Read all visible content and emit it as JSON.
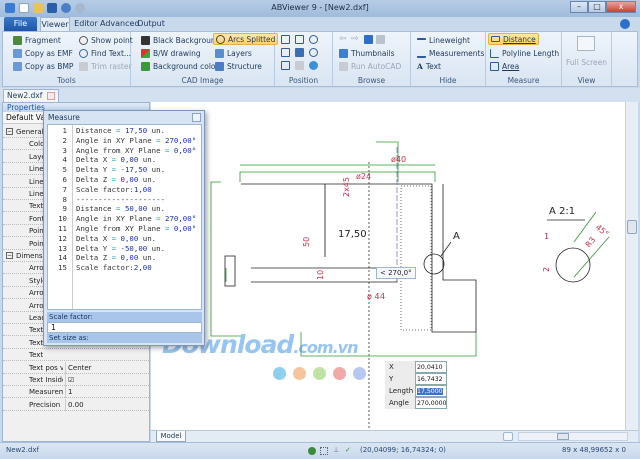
{
  "window": {
    "title": "ABViewer 9 - [New2.dxf]",
    "minimize": "–",
    "maximize": "□",
    "close": "x"
  },
  "menu_tabs": [
    "File",
    "Viewer",
    "Editor",
    "Advanced",
    "Output"
  ],
  "ribbon": {
    "tools": {
      "label": "Tools",
      "items": [
        "Fragment",
        "Show point",
        "Copy as EMF",
        "Find Text...",
        "Copy as BMP",
        "Trim raster"
      ]
    },
    "cad_image": {
      "label": "CAD Image",
      "items": [
        "Black Background",
        "Arcs Splitted",
        "B/W drawing",
        "Layers",
        "Background color",
        "Structure"
      ]
    },
    "position": {
      "label": "Position"
    },
    "browse": {
      "label": "Browse",
      "items": [
        "Thumbnails",
        "Run AutoCAD"
      ]
    },
    "hide": {
      "label": "Hide",
      "items": [
        "Lineweight",
        "Measurements",
        "Text"
      ]
    },
    "measure": {
      "label": "Measure",
      "items": [
        "Distance",
        "Polyline Length",
        "Area"
      ]
    },
    "view": {
      "label": "View",
      "items": [
        "Full Screen"
      ]
    }
  },
  "doc_tab": "New2.dxf",
  "properties": {
    "title": "Properties",
    "default_values": "Default Valu",
    "rows": [
      {
        "name": "General",
        "value": "",
        "cat": true
      },
      {
        "name": "Color",
        "value": ""
      },
      {
        "name": "Layer",
        "value": ""
      },
      {
        "name": "Linetype",
        "value": ""
      },
      {
        "name": "Linetype",
        "value": ""
      },
      {
        "name": "Line W",
        "value": ""
      },
      {
        "name": "Text",
        "value": ""
      },
      {
        "name": "Font",
        "value": ""
      },
      {
        "name": "Point",
        "value": ""
      },
      {
        "name": "Point",
        "value": ""
      },
      {
        "name": "Dimension",
        "value": "",
        "cat": true
      },
      {
        "name": "Arrow",
        "value": ""
      },
      {
        "name": "Style",
        "value": ""
      },
      {
        "name": "Arrow",
        "value": ""
      },
      {
        "name": "Arrow",
        "value": ""
      },
      {
        "name": "Leader",
        "value": ""
      },
      {
        "name": "Text",
        "value": ""
      },
      {
        "name": "Text",
        "value": ""
      },
      {
        "name": "Text",
        "value": ""
      },
      {
        "name": "Text pos ve",
        "value": "Center"
      },
      {
        "name": "Text Inside",
        "value": "☑"
      },
      {
        "name": "Measuremen",
        "value": "1"
      },
      {
        "name": "Precision",
        "value": "0.00"
      }
    ]
  },
  "measure_panel": {
    "title": "Measure",
    "lines": [
      "Distance = 17,50 un.",
      "Angle in XY Plane = 270,00°",
      "Angle from XY Plane = 0,00°",
      "Delta X = 0,00 un.",
      "Delta Y = -17,50 un.",
      "Delta Z = 0,00 un.",
      "Scale factor:1,00",
      "--------------------",
      "Distance = 50,00 un.",
      "Angle in XY Plane = 270,00°",
      "Angle from XY Plane = 0,00°",
      "Delta X = 0,00 un.",
      "Delta Y = -50,00 un.",
      "Delta Z = 0,00 un.",
      "Scale factor:2,00"
    ],
    "scale_factor_label": "Scale factor:",
    "scale_factor_value": "1",
    "set_size_label": "Set size as:"
  },
  "drawing": {
    "dims": {
      "d40": "ø40",
      "d24": "ø24",
      "chamfer": "2x45",
      "h50": "50",
      "h10": "10",
      "d4": "ø 4",
      "d4b": "4",
      "measured": "17,50",
      "section": "A",
      "detail_title": "A  2:1",
      "d1": "1",
      "d2": "2",
      "r3": "R3",
      "a45": "45°"
    },
    "angle_tip": "< 270,0°",
    "readout": {
      "x_label": "X",
      "x": "20,0410",
      "y_label": "Y",
      "y": "16,7432",
      "length_label": "Length",
      "length": "17,5000",
      "angle_label": "Angle",
      "angle": "270,0000"
    }
  },
  "watermark": {
    "text": "Download",
    "suffix": ".com.vn",
    "dot_colors": [
      "#8fd0ef",
      "#f3c6a0",
      "#bfe3a5",
      "#f2a9a9",
      "#b7c9f0"
    ]
  },
  "model_tab": "Model",
  "status": {
    "file": "New2.dxf",
    "coords": "(20,04099; 16,74324; 0)",
    "size": "89 x 48,99652 x 0"
  },
  "colors": {
    "dim_green": "#2e9a2e",
    "dim_red": "#d0304a",
    "highlight": "#fbd36a",
    "accent_blue": "#1e55a8"
  }
}
